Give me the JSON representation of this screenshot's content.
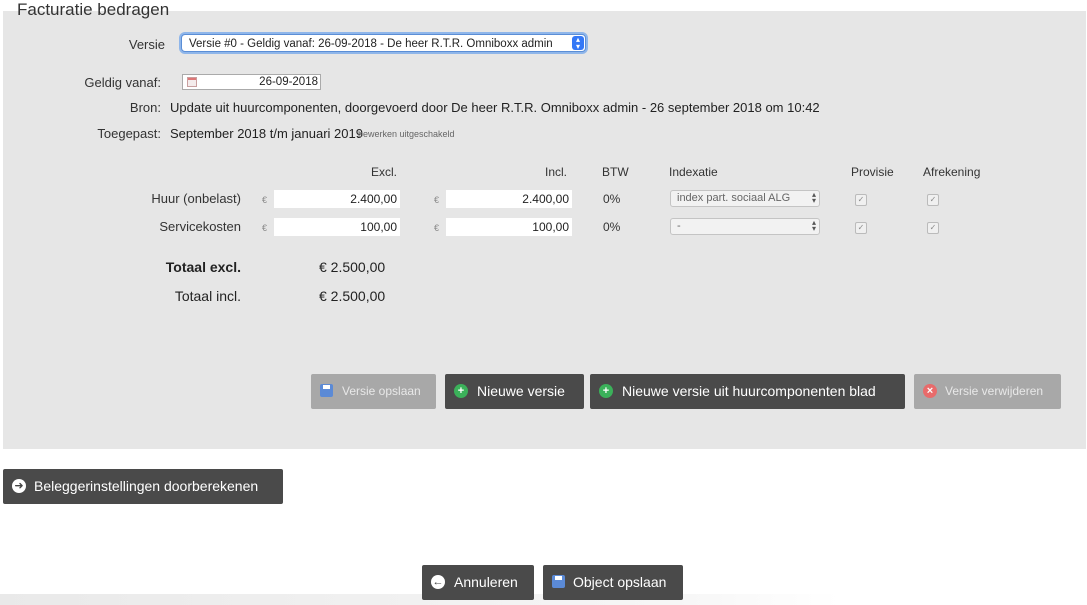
{
  "section": {
    "legend": "Facturatie bedragen"
  },
  "versie": {
    "label": "Versie",
    "selected": "Versie #0 - Geldig vanaf: 26-09-2018 - De heer R.T.R. Omniboxx admin"
  },
  "geldig_vanaf": {
    "label": "Geldig vanaf:",
    "value": "26-09-2018"
  },
  "bron": {
    "label": "Bron:",
    "value": "Update uit huurcomponenten, doorgevoerd door De heer R.T.R. Omniboxx admin - 26 september 2018 om 10:42"
  },
  "toegepast": {
    "label": "Toegepast:",
    "value": "September 2018 t/m januari 2019",
    "note": "bewerken uitgeschakeld"
  },
  "columns": {
    "excl": "Excl.",
    "incl": "Incl.",
    "btw": "BTW",
    "indexatie": "Indexatie",
    "provisie": "Provisie",
    "afrekening": "Afrekening"
  },
  "currency_symbol": "€",
  "rows": [
    {
      "label": "Huur (onbelast)",
      "excl": "2.400,00",
      "incl": "2.400,00",
      "btw": "0%",
      "indexatie": "index part. sociaal ALG",
      "provisie": true,
      "afrekening": true
    },
    {
      "label": "Servicekosten",
      "excl": "100,00",
      "incl": "100,00",
      "btw": "0%",
      "indexatie": "-",
      "provisie": true,
      "afrekening": true
    }
  ],
  "totals": {
    "excl_label": "Totaal excl.",
    "excl_value": "€ 2.500,00",
    "incl_label": "Totaal incl.",
    "incl_value": "€ 2.500,00"
  },
  "buttons": {
    "versie_opslaan": "Versie opslaan",
    "nieuwe_versie": "Nieuwe versie",
    "nieuwe_versie_blad": "Nieuwe versie uit huurcomponenten blad",
    "versie_verwijderen": "Versie verwijderen",
    "beleggerinstellingen": "Beleggerinstellingen doorberekenen",
    "annuleren": "Annuleren",
    "object_opslaan": "Object opslaan"
  },
  "icons": {
    "save": "floppy-disk-icon",
    "add": "plus-circle-icon",
    "remove": "x-circle-icon",
    "forward": "arrow-right-circle-icon",
    "back": "arrow-left-circle-icon",
    "calendar": "calendar-icon"
  },
  "colors": {
    "panel_bg": "#e6e6e6",
    "button_dark": "#4a4a4a",
    "button_disabled": "#a8a8a8",
    "add_green": "#3bb15a",
    "remove_red": "#e86b6b",
    "focus_blue": "#3478f6"
  }
}
